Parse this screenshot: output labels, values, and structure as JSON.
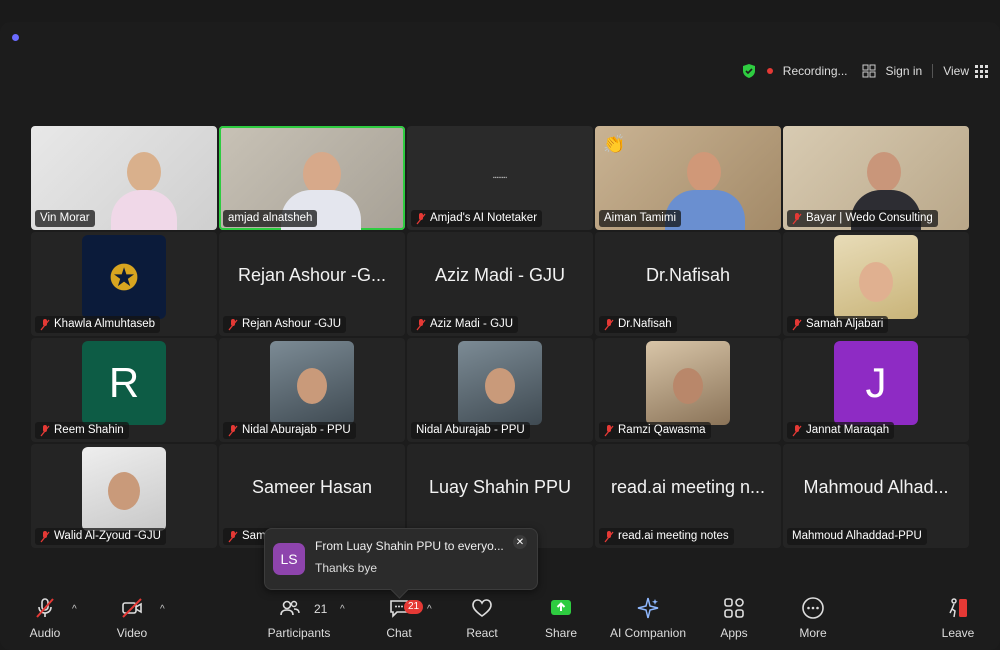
{
  "topbar": {
    "recording": "Recording...",
    "sign_in": "Sign in",
    "view": "View"
  },
  "tiles": [
    {
      "label": "Vin Morar",
      "muted": false
    },
    {
      "label": "amjad alnatsheh",
      "muted": false,
      "active": true
    },
    {
      "label": "Amjad's AI Notetaker",
      "muted": true
    },
    {
      "label": "Aiman Tamimi",
      "muted": false
    },
    {
      "label": "Bayar | Wedo Consulting",
      "muted": true
    },
    {
      "label": "Khawla Almuhtaseb",
      "muted": true
    },
    {
      "label": "Rejan Ashour -GJU",
      "muted": true,
      "big": "Rejan Ashour -G..."
    },
    {
      "label": "Aziz Madi - GJU",
      "muted": true,
      "big": "Aziz Madi - GJU"
    },
    {
      "label": "Dr.Nafisah",
      "muted": true,
      "big": "Dr.Nafisah"
    },
    {
      "label": "Samah Aljabari",
      "muted": true
    },
    {
      "label": "Reem Shahin",
      "muted": true,
      "letter": "R"
    },
    {
      "label": "Nidal Aburajab - PPU",
      "muted": true
    },
    {
      "label": "Nidal Aburajab - PPU",
      "muted": false
    },
    {
      "label": "Ramzi Qawasma",
      "muted": true
    },
    {
      "label": "Jannat Maraqah",
      "muted": true,
      "letter": "J"
    },
    {
      "label": "Walid Al-Zyoud -GJU",
      "muted": true
    },
    {
      "label": "Sam",
      "muted": true,
      "big": "Sameer Hasan"
    },
    {
      "label": "",
      "muted": false,
      "big": "Luay Shahin PPU"
    },
    {
      "label": "read.ai meeting notes",
      "muted": true,
      "big": "read.ai meeting n..."
    },
    {
      "label": "Mahmoud Alhaddad-PPU",
      "muted": false,
      "big": "Mahmoud Alhad..."
    }
  ],
  "chat_toast": {
    "initials": "LS",
    "from": "From Luay Shahin PPU to everyo...",
    "message": "Thanks bye"
  },
  "toolbar": {
    "audio": "Audio",
    "video": "Video",
    "participants": "Participants",
    "participants_count": "21",
    "chat": "Chat",
    "chat_badge": "21",
    "react": "React",
    "share": "Share",
    "ai_companion": "AI Companion",
    "apps": "Apps",
    "more": "More",
    "leave": "Leave"
  },
  "colors": {
    "active_border": "#2ecc40",
    "share_green": "#2ecc40",
    "letter_r_bg": "#0d5c45",
    "letter_j_bg": "#8e2bc4",
    "toast_avatar_bg": "#8e44ad"
  }
}
